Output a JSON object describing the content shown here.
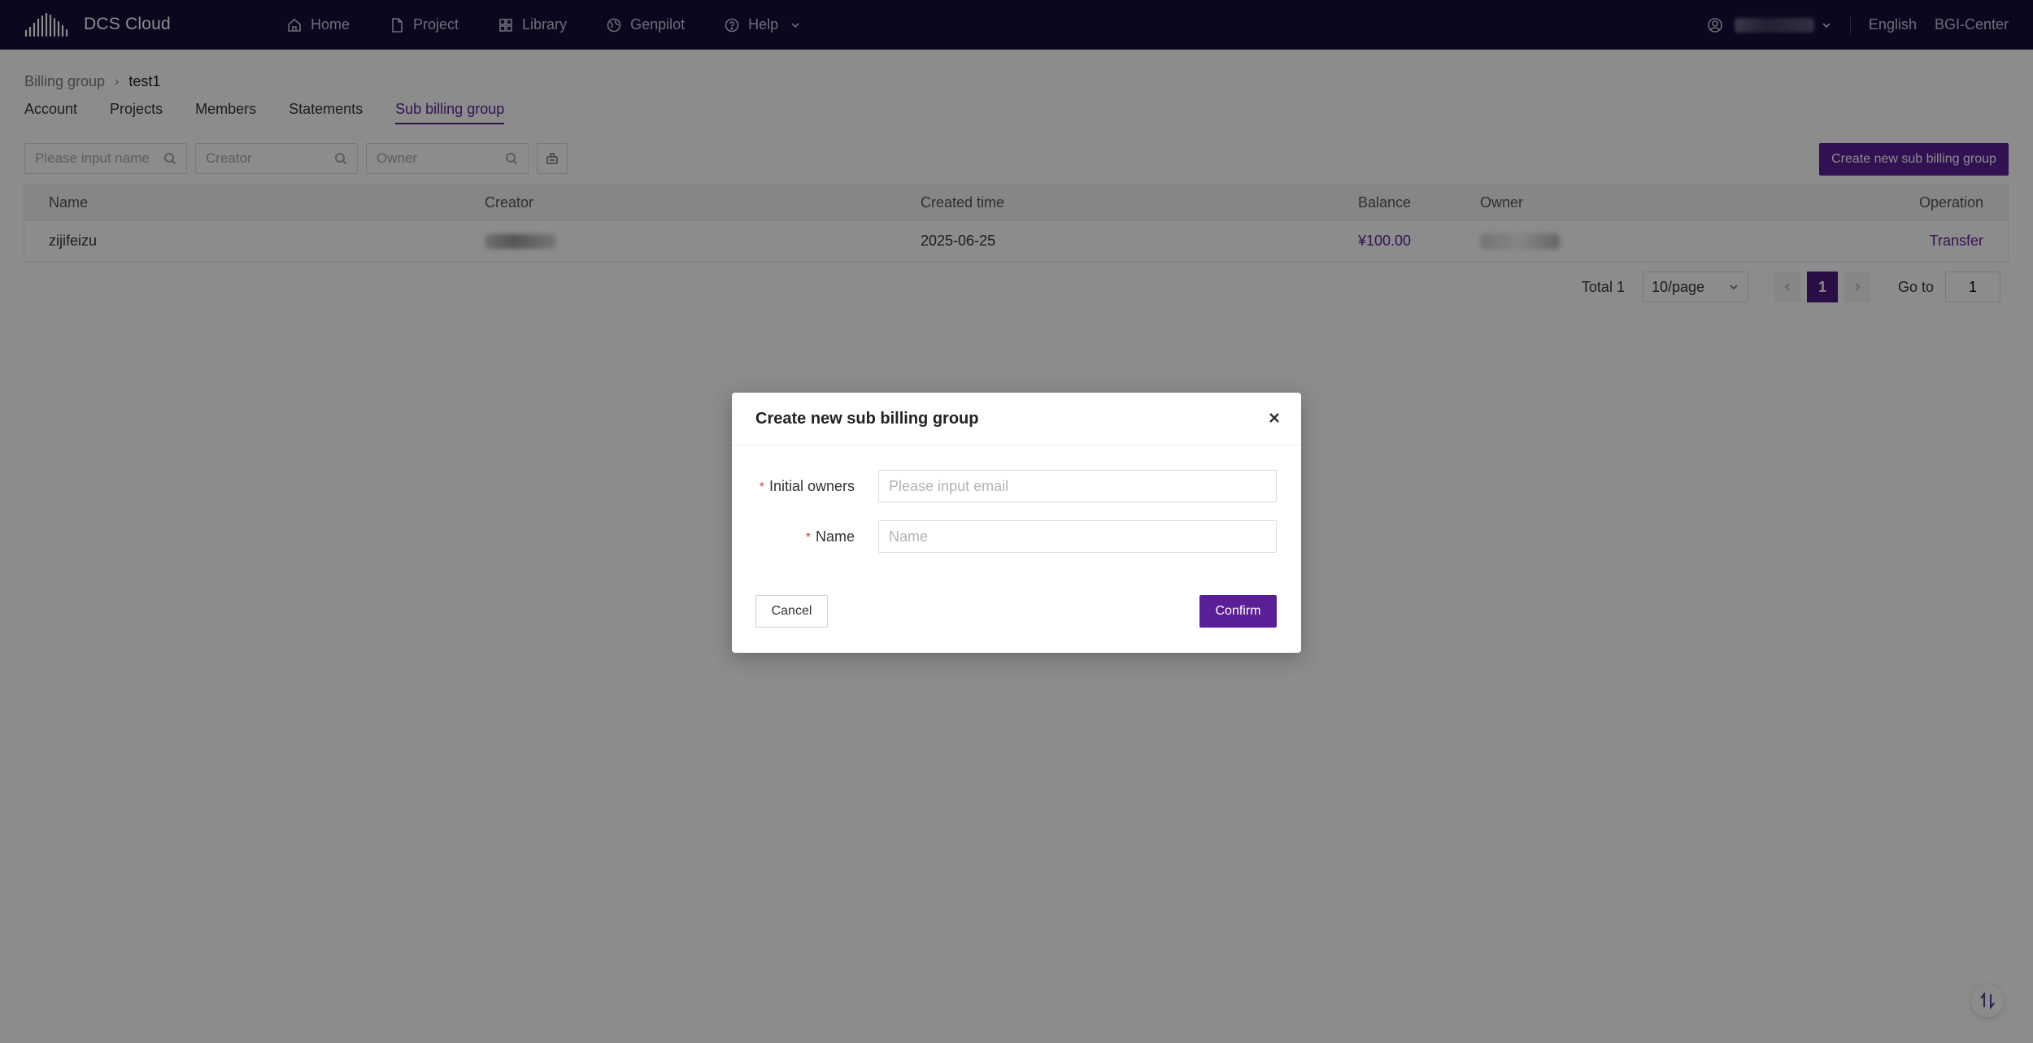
{
  "app": {
    "name": "DCS Cloud",
    "colors": {
      "nav_bg": "#160b3a",
      "accent": "#5a1f96",
      "required": "#e23a3a"
    }
  },
  "nav": {
    "items": [
      {
        "label": "Home",
        "icon": "home-icon"
      },
      {
        "label": "Project",
        "icon": "document-icon"
      },
      {
        "label": "Library",
        "icon": "grid-icon"
      },
      {
        "label": "Genpilot",
        "icon": "globe-icon"
      },
      {
        "label": "Help",
        "icon": "question-icon"
      }
    ],
    "language": "English",
    "organization": "BGI-Center"
  },
  "breadcrumb": {
    "root": "Billing group",
    "current": "test1"
  },
  "tabs": [
    {
      "label": "Account"
    },
    {
      "label": "Projects"
    },
    {
      "label": "Members"
    },
    {
      "label": "Statements"
    },
    {
      "label": "Sub billing group",
      "active": true
    }
  ],
  "filters": {
    "name_placeholder": "Please input name",
    "creator_placeholder": "Creator",
    "owner_placeholder": "Owner"
  },
  "create_button": "Create new sub billing group",
  "table": {
    "columns": [
      "Name",
      "Creator",
      "Created time",
      "Balance",
      "Owner",
      "Operation"
    ],
    "rows": [
      {
        "name": "zijifeizu",
        "created": "2025-06-25",
        "balance": "¥100.00",
        "operation": "Transfer"
      }
    ]
  },
  "pagination": {
    "total": "Total 1",
    "page_size": "10/page",
    "current_page": "1",
    "goto_label": "Go to",
    "goto_value": "1"
  },
  "modal": {
    "title": "Create new sub billing group",
    "fields": [
      {
        "label": "Initial owners",
        "placeholder": "Please input email",
        "required": true
      },
      {
        "label": "Name",
        "placeholder": "Name",
        "required": true
      }
    ],
    "cancel": "Cancel",
    "confirm": "Confirm"
  }
}
